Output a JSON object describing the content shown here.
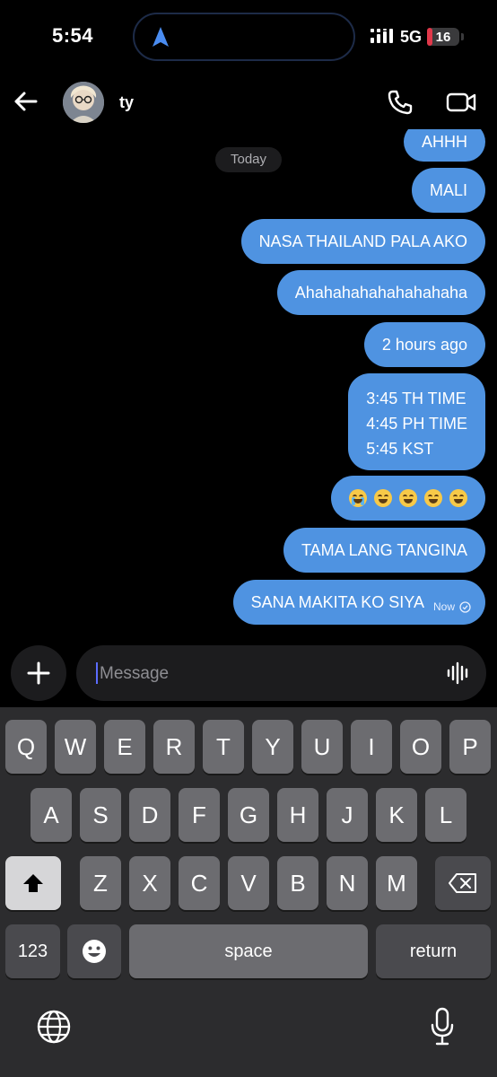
{
  "status": {
    "time": "5:54",
    "network": "5G",
    "battery": "16",
    "battery_level": 0.16
  },
  "header": {
    "contact_name": "ty",
    "icons": [
      "back-arrow-icon",
      "phone-icon",
      "video-camera-icon"
    ]
  },
  "chat": {
    "day_separator": "Today",
    "messages": [
      {
        "text": "AHHH"
      },
      {
        "text": "MALI"
      },
      {
        "text": "NASA THAILAND PALA AKO"
      },
      {
        "text": "Ahahahahahahahahaha"
      },
      {
        "text": "2 hours ago"
      },
      {
        "lines": [
          "3:45 TH TIME",
          "4:45 PH TIME",
          "5:45 KST"
        ]
      },
      {
        "emojis": [
          "loudly-crying-face",
          "face-with-tears-of-joy",
          "face-with-tears-of-joy",
          "face-with-tears-of-joy",
          "face-with-tears-of-joy"
        ]
      },
      {
        "text": "TAMA LANG TANGINA"
      },
      {
        "text": "SANA MAKITA KO SIYA",
        "time": "Now",
        "status_icon": "seen-check-icon"
      }
    ]
  },
  "composer": {
    "placeholder": "Message",
    "icons": [
      "plus-icon",
      "voice-waveform-icon"
    ]
  },
  "keyboard": {
    "row1": [
      "Q",
      "W",
      "E",
      "R",
      "T",
      "Y",
      "U",
      "I",
      "O",
      "P"
    ],
    "row2": [
      "A",
      "S",
      "D",
      "F",
      "G",
      "H",
      "J",
      "K",
      "L"
    ],
    "row3": [
      "Z",
      "X",
      "C",
      "V",
      "B",
      "N",
      "M"
    ],
    "numbers_label": "123",
    "space_label": "space",
    "return_label": "return",
    "icons": [
      "shift-icon",
      "backspace-icon",
      "emoji-icon",
      "globe-icon",
      "microphone-icon"
    ]
  },
  "colors": {
    "outgoing_bubble": "#4f93e1",
    "background": "#000000",
    "keyboard": "#2c2c2e",
    "key": "#6c6c70"
  }
}
